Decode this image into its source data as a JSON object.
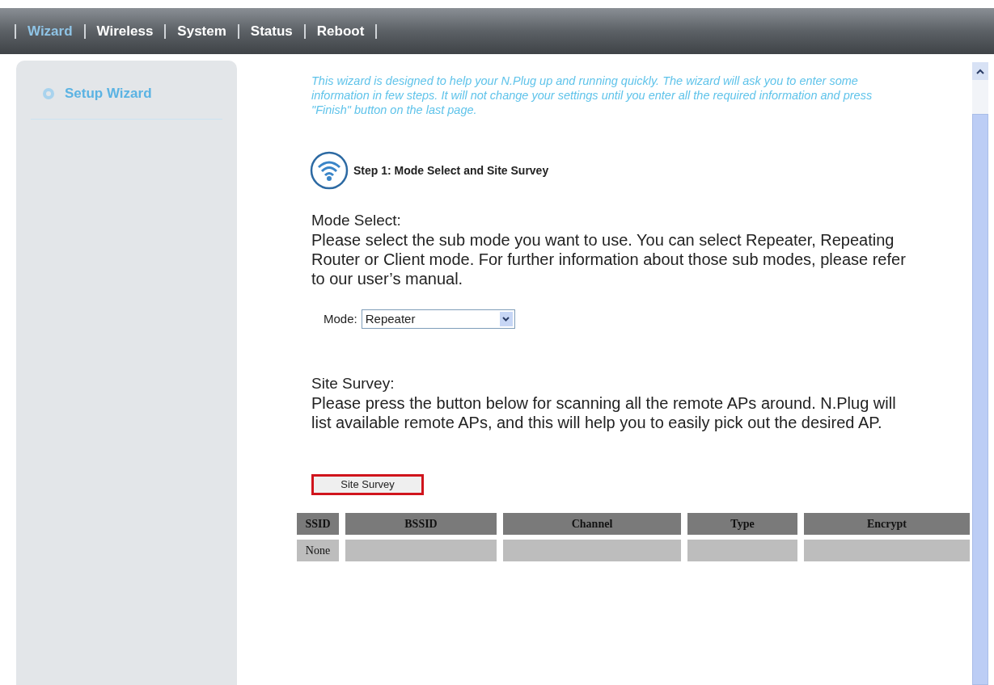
{
  "nav": [
    {
      "label": "Wizard",
      "selected": true
    },
    {
      "label": "Wireless",
      "selected": false
    },
    {
      "label": "System",
      "selected": false
    },
    {
      "label": "Status",
      "selected": false
    },
    {
      "label": "Reboot",
      "selected": false
    }
  ],
  "sidebar": {
    "items": [
      {
        "label": "Setup Wizard",
        "selected": true
      }
    ]
  },
  "intro": "This wizard is designed to help your N.Plug up and running quickly. The wizard will ask you to enter some information in few steps. It will not change your settings until you enter all the required information and press \"Finish\" button on the last page.",
  "step_title": "Step 1: Mode Select and Site Survey",
  "mode_section": {
    "heading": "Mode Select:",
    "text": "Please select the sub mode you want to use. You can select Repeater, Repeating Router or Client mode. For further information about those sub modes, please refer to our user’s manual.",
    "label": "Mode:",
    "value": "Repeater"
  },
  "survey_section": {
    "heading": "Site Survey:",
    "text": "Please press the button below for scanning all the remote APs around. N.Plug will list available remote APs, and this will help you to easily pick out the desired AP.",
    "button": "Site Survey"
  },
  "table": {
    "columns": [
      "SSID",
      "BSSID",
      "Channel",
      "Type",
      "Encrypt"
    ],
    "rows": [
      [
        "None",
        "",
        "",
        "",
        ""
      ]
    ]
  }
}
